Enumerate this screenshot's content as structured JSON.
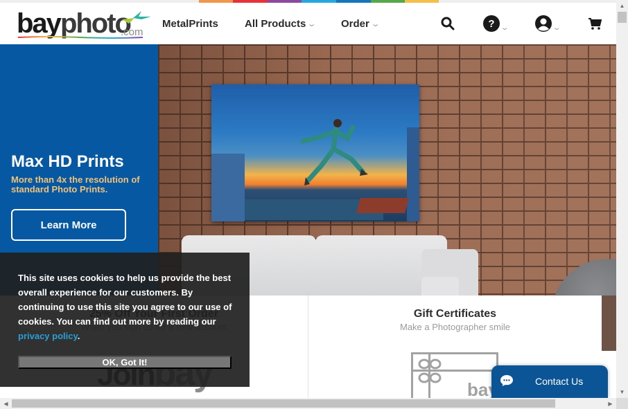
{
  "brand": {
    "logo_word_a": "bay",
    "logo_word_b": "photo",
    "logo_suffix": ".com",
    "accent": "#0758a2",
    "strip_colors": [
      "#eeeeee",
      "#f0954a",
      "#e8323a",
      "#8b4a9e",
      "#27a8df",
      "#1476bd",
      "#56a84a",
      "#f6be4a"
    ]
  },
  "nav": {
    "items": [
      {
        "label": "MetalPrints",
        "has_dropdown": false
      },
      {
        "label": "All Products",
        "has_dropdown": true
      },
      {
        "label": "Order",
        "has_dropdown": true
      }
    ],
    "chevron": "⌄",
    "icons": [
      "search-icon",
      "help-icon",
      "account-icon",
      "cart-icon"
    ]
  },
  "hero": {
    "title": "Max HD Prints",
    "subtitle": "More than 4x the resolution of standard Photo Prints.",
    "button_label": "Learn More"
  },
  "cards": [
    {
      "title": "25% Off Your First Order",
      "subtitle": "When you sign up for a new account",
      "image_text_a": "Join",
      "image_text_b": "bay"
    },
    {
      "title": "Gift Certificates",
      "subtitle": "Make a Photographer smile",
      "image_text": "bay"
    }
  ],
  "cookie": {
    "text": "This site uses cookies to help us provide the best overall experience for our customers. By continuing to use this site you agree to our use of cookies. You can find out more by reading our ",
    "link_text": "privacy policy",
    "after_link": ".",
    "button_label": "OK, Got It!"
  },
  "contact": {
    "label": "Contact Us"
  },
  "scrollbars": {
    "up": "▲",
    "down": "▼",
    "left": "◀",
    "right": "▶"
  }
}
